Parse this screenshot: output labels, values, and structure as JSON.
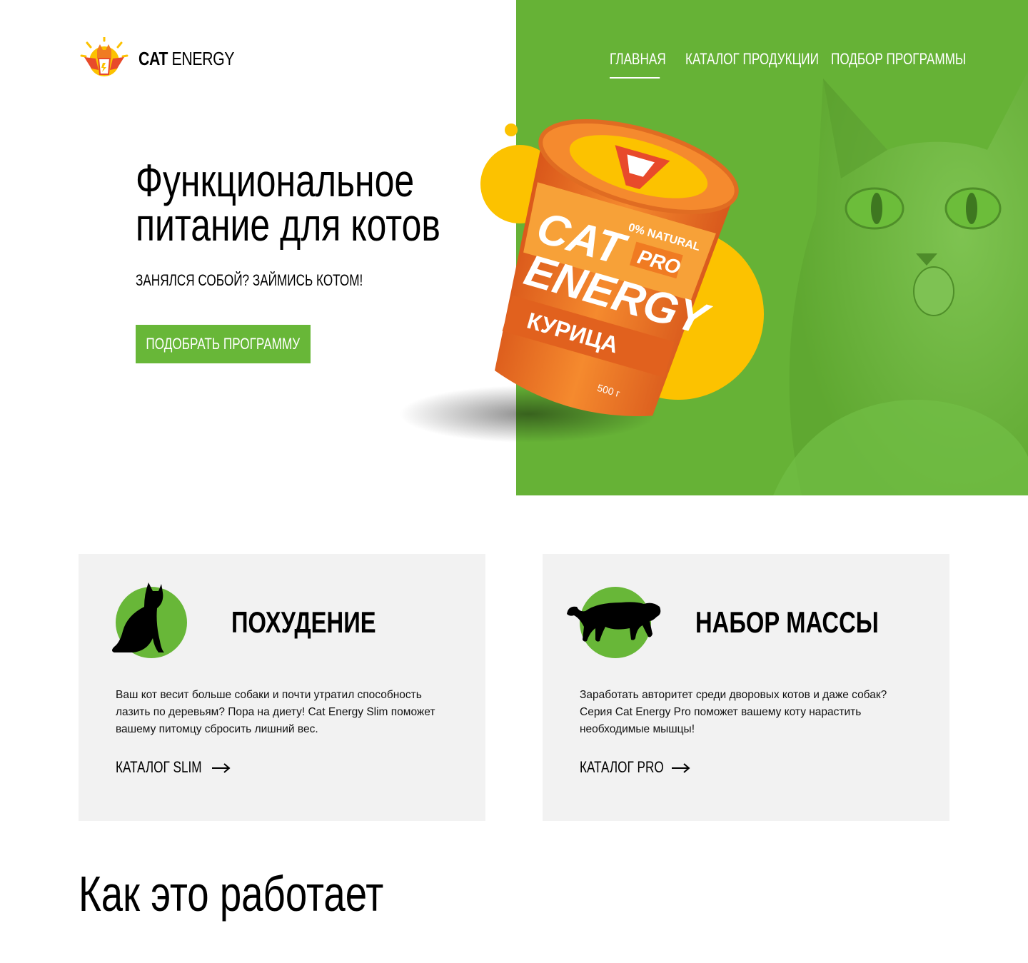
{
  "header": {
    "logo": {
      "brand_bold": "CAT",
      "brand_light": "ENERGY"
    },
    "nav": [
      {
        "label": "ГЛАВНАЯ",
        "active": true
      },
      {
        "label": "КАТАЛОГ ПРОДУКЦИИ",
        "active": false
      },
      {
        "label": "ПОДБОР ПРОГРАММЫ",
        "active": false
      }
    ]
  },
  "hero": {
    "title_line1": "Функциональное",
    "title_line2": "питание для котов",
    "subtitle": "ЗАНЯЛСЯ СОБОЙ? ЗАЙМИСЬ КОТОМ!",
    "button_label": "ПОДОБРАТЬ ПРОГРАММУ",
    "product": {
      "badge": "0% NATURAL",
      "name_line1": "CAT",
      "name_line2": "ENERGY",
      "tag": "PRO",
      "flavor": "КУРИЦА",
      "weight": "500 г"
    }
  },
  "programs": [
    {
      "title": "ПОХУДЕНИЕ",
      "text": "Ваш кот весит больше собаки и почти утратил способность лазить по деревьям? Пора на диету! Cat Energy Slim поможет вашему питомцу сбросить лишний вес.",
      "link": "КАТАЛОГ SLIM",
      "icon": "sitting-cat-icon"
    },
    {
      "title": "НАБОР МАССЫ",
      "text": "Заработать авторитет среди дворовых котов и даже собак? Серия Cat Energy Pro поможет вашему коту нарастить необходимые мышцы!",
      "link": "КАТАЛОГ PRO",
      "icon": "panther-icon"
    }
  ],
  "how_it_works": {
    "title": "Как это работает"
  },
  "colors": {
    "accent": "#68b738",
    "yellow": "#fcc200",
    "orange": "#f07b22",
    "card_bg": "#f2f2f2"
  }
}
